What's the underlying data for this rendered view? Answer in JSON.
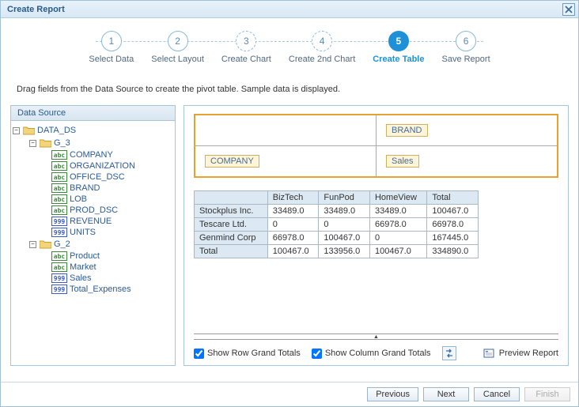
{
  "dialog": {
    "title": "Create Report"
  },
  "steps": [
    {
      "num": "1",
      "label": "Select Data"
    },
    {
      "num": "2",
      "label": "Select Layout"
    },
    {
      "num": "3",
      "label": "Create Chart"
    },
    {
      "num": "4",
      "label": "Create 2nd Chart"
    },
    {
      "num": "5",
      "label": "Create Table"
    },
    {
      "num": "6",
      "label": "Save Report"
    }
  ],
  "instruction": "Drag fields from the Data Source to create the pivot table. Sample data is displayed.",
  "panel": {
    "dataSourceTitle": "Data Source"
  },
  "tree": {
    "root": "DATA_DS",
    "g3": "G_3",
    "g3_items": [
      {
        "label": "COMPANY",
        "type": "abc"
      },
      {
        "label": "ORGANIZATION",
        "type": "abc"
      },
      {
        "label": "OFFICE_DSC",
        "type": "abc"
      },
      {
        "label": "BRAND",
        "type": "abc"
      },
      {
        "label": "LOB",
        "type": "abc"
      },
      {
        "label": "PROD_DSC",
        "type": "abc"
      },
      {
        "label": "REVENUE",
        "type": "999"
      },
      {
        "label": "UNITS",
        "type": "999"
      }
    ],
    "g2": "G_2",
    "g2_items": [
      {
        "label": "Product",
        "type": "abc"
      },
      {
        "label": "Market",
        "type": "abc"
      },
      {
        "label": "Sales",
        "type": "999"
      },
      {
        "label": "Total_Expenses",
        "type": "999"
      }
    ]
  },
  "drop": {
    "col_field": "BRAND",
    "row_field": "COMPANY",
    "data_field": "Sales"
  },
  "pivot": {
    "columns": [
      "BizTech",
      "FunPod",
      "HomeView",
      "Total"
    ],
    "rows": [
      {
        "label": "Stockplus Inc.",
        "cells": [
          "33489.0",
          "33489.0",
          "33489.0",
          "100467.0"
        ]
      },
      {
        "label": "Tescare Ltd.",
        "cells": [
          "0",
          "0",
          "66978.0",
          "66978.0"
        ]
      },
      {
        "label": "Genmind Corp",
        "cells": [
          "66978.0",
          "100467.0",
          "0",
          "167445.0"
        ]
      },
      {
        "label": "Total",
        "cells": [
          "100467.0",
          "133956.0",
          "100467.0",
          "334890.0"
        ]
      }
    ]
  },
  "options": {
    "showRowGrandTotals": "Show Row Grand Totals",
    "showColGrandTotals": "Show Column Grand Totals",
    "previewReport": "Preview Report"
  },
  "footer": {
    "previous": "Previous",
    "next": "Next",
    "cancel": "Cancel",
    "finish": "Finish"
  }
}
